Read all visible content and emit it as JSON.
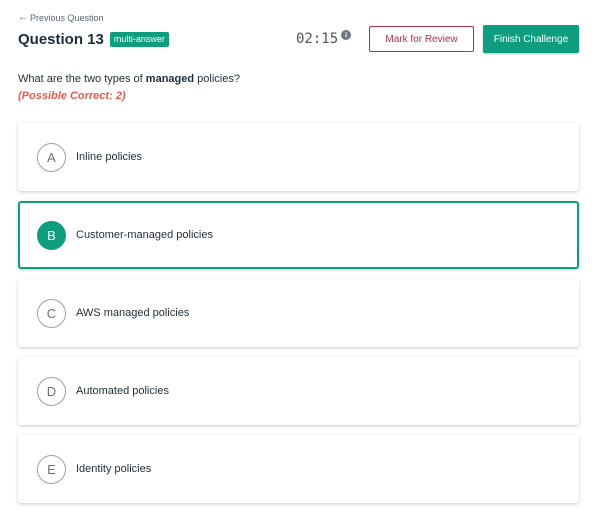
{
  "nav": {
    "back_icon": "arrow-left-icon",
    "back_label": "Previous Question"
  },
  "question": {
    "title": "Question 13",
    "type_badge": "multi-answer",
    "prompt_before": "What are the two types of ",
    "prompt_bold": "managed",
    "prompt_after": " policies?",
    "possible_correct": "(Possible Correct: 2)"
  },
  "timer": {
    "value": "02:15",
    "info_icon": "info-icon",
    "info_glyph": "i"
  },
  "actions": {
    "review_label": "Mark for Review",
    "finish_label": "Finish Challenge"
  },
  "colors": {
    "accent": "#0f9d80",
    "review": "#b2314f",
    "possible": "#e85a4f"
  },
  "options": [
    {
      "letter": "A",
      "label": "Inline policies",
      "selected": false
    },
    {
      "letter": "B",
      "label": "Customer-managed policies",
      "selected": true
    },
    {
      "letter": "C",
      "label": "AWS managed policies",
      "selected": false
    },
    {
      "letter": "D",
      "label": "Automated policies",
      "selected": false
    },
    {
      "letter": "E",
      "label": "Identity policies",
      "selected": false
    }
  ]
}
